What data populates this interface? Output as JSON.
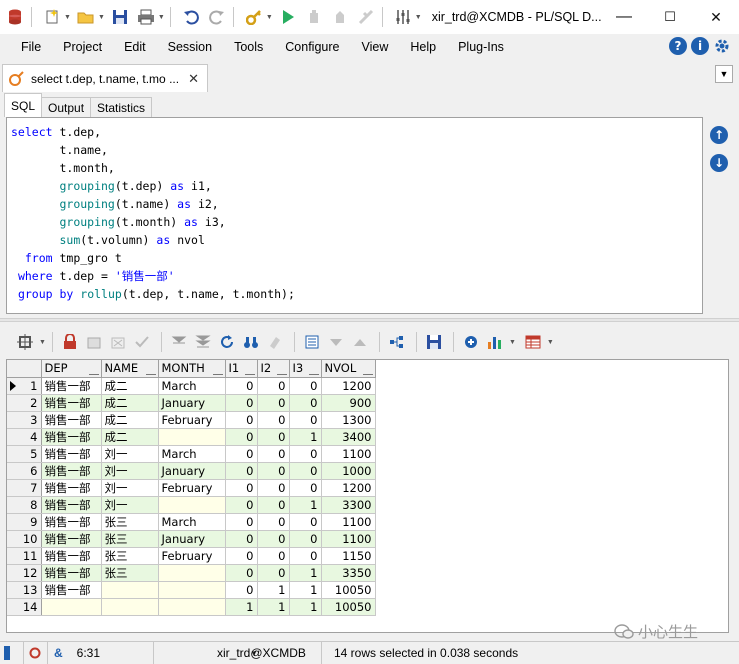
{
  "window": {
    "title": "xir_trd@XCMDB - PL/SQL D...",
    "controls": {
      "minimize": "—",
      "maximize": "☐",
      "close": "✕"
    }
  },
  "menu": [
    "File",
    "Project",
    "Edit",
    "Session",
    "Tools",
    "Configure",
    "View",
    "Help",
    "Plug-Ins"
  ],
  "document_tab": {
    "label": "select t.dep, t.name, t.mo ...",
    "close": "✕"
  },
  "sql_tabs": [
    "SQL",
    "Output",
    "Statistics"
  ],
  "sql": {
    "lines": [
      [
        {
          "t": "kw",
          "v": "select"
        },
        {
          "t": "tx",
          "v": " t.dep,"
        }
      ],
      [
        {
          "t": "tx",
          "v": "       t.name,"
        }
      ],
      [
        {
          "t": "tx",
          "v": "       t.month,"
        }
      ],
      [
        {
          "t": "tx",
          "v": "       "
        },
        {
          "t": "fn",
          "v": "grouping"
        },
        {
          "t": "tx",
          "v": "(t.dep) "
        },
        {
          "t": "kw",
          "v": "as"
        },
        {
          "t": "tx",
          "v": " i1,"
        }
      ],
      [
        {
          "t": "tx",
          "v": "       "
        },
        {
          "t": "fn",
          "v": "grouping"
        },
        {
          "t": "tx",
          "v": "(t.name) "
        },
        {
          "t": "kw",
          "v": "as"
        },
        {
          "t": "tx",
          "v": " i2,"
        }
      ],
      [
        {
          "t": "tx",
          "v": "       "
        },
        {
          "t": "fn",
          "v": "grouping"
        },
        {
          "t": "tx",
          "v": "(t.month) "
        },
        {
          "t": "kw",
          "v": "as"
        },
        {
          "t": "tx",
          "v": " i3,"
        }
      ],
      [
        {
          "t": "tx",
          "v": "       "
        },
        {
          "t": "fn",
          "v": "sum"
        },
        {
          "t": "tx",
          "v": "(t.volumn) "
        },
        {
          "t": "kw",
          "v": "as"
        },
        {
          "t": "tx",
          "v": " nvol"
        }
      ],
      [
        {
          "t": "tx",
          "v": "  "
        },
        {
          "t": "kw",
          "v": "from"
        },
        {
          "t": "tx",
          "v": " tmp_gro t"
        }
      ],
      [
        {
          "t": "tx",
          "v": " "
        },
        {
          "t": "kw",
          "v": "where"
        },
        {
          "t": "tx",
          "v": " t.dep = "
        },
        {
          "t": "str",
          "v": "'销售一部'"
        }
      ],
      [
        {
          "t": "tx",
          "v": " "
        },
        {
          "t": "kw",
          "v": "group by"
        },
        {
          "t": "tx",
          "v": " "
        },
        {
          "t": "fn",
          "v": "rollup"
        },
        {
          "t": "tx",
          "v": "(t.dep, t.name, t.month);"
        }
      ]
    ]
  },
  "grid": {
    "columns": [
      "DEP",
      "NAME",
      "MONTH",
      "I1",
      "I2",
      "I3",
      "NVOL"
    ],
    "rows": [
      [
        "1",
        "销售一部",
        "成二",
        "March",
        "0",
        "0",
        "0",
        "1200"
      ],
      [
        "2",
        "销售一部",
        "成二",
        "January",
        "0",
        "0",
        "0",
        "900"
      ],
      [
        "3",
        "销售一部",
        "成二",
        "February",
        "0",
        "0",
        "0",
        "1300"
      ],
      [
        "4",
        "销售一部",
        "成二",
        "",
        "0",
        "0",
        "1",
        "3400"
      ],
      [
        "5",
        "销售一部",
        "刘一",
        "March",
        "0",
        "0",
        "0",
        "1100"
      ],
      [
        "6",
        "销售一部",
        "刘一",
        "January",
        "0",
        "0",
        "0",
        "1000"
      ],
      [
        "7",
        "销售一部",
        "刘一",
        "February",
        "0",
        "0",
        "0",
        "1200"
      ],
      [
        "8",
        "销售一部",
        "刘一",
        "",
        "0",
        "0",
        "1",
        "3300"
      ],
      [
        "9",
        "销售一部",
        "张三",
        "March",
        "0",
        "0",
        "0",
        "1100"
      ],
      [
        "10",
        "销售一部",
        "张三",
        "January",
        "0",
        "0",
        "0",
        "1100"
      ],
      [
        "11",
        "销售一部",
        "张三",
        "February",
        "0",
        "0",
        "0",
        "1150"
      ],
      [
        "12",
        "销售一部",
        "张三",
        "",
        "0",
        "0",
        "1",
        "3350"
      ],
      [
        "13",
        "销售一部",
        "",
        "",
        "0",
        "1",
        "1",
        "10050"
      ],
      [
        "14",
        "",
        "",
        "",
        "1",
        "1",
        "1",
        "10050"
      ]
    ]
  },
  "status": {
    "position": "6:31",
    "connection": "xir_trd@XCMDB",
    "message": "14 rows selected in 0.038 seconds"
  },
  "watermark": "小心生生",
  "colors": {
    "keyword": "#0000ff",
    "function": "#008080",
    "row_alt": "#e8f8e0",
    "dim_cell": "#ffffe8"
  }
}
